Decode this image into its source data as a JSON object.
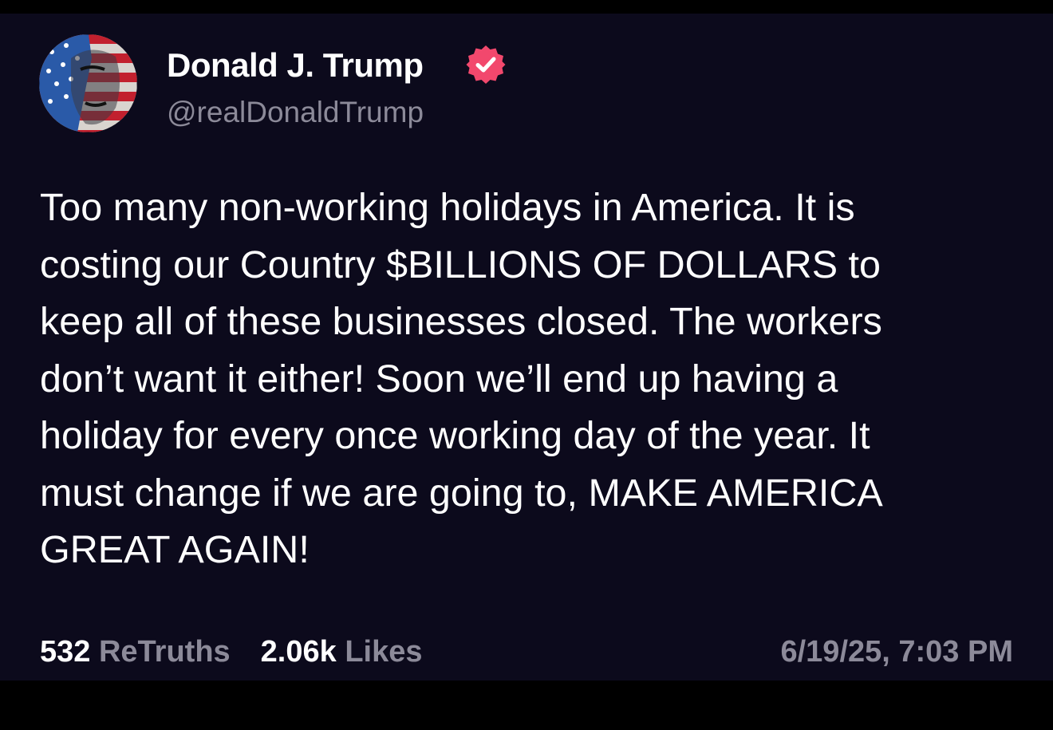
{
  "author": {
    "display_name": "Donald J. Trump",
    "handle": "@realDonaldTrump",
    "verified": true,
    "verified_icon": "verified-badge-icon",
    "avatar_icon": "stars-and-stripes-portrait-avatar"
  },
  "post": {
    "lines": [
      "Too many non-working holidays in America. It is",
      "costing our Country $BILLIONS OF DOLLARS to",
      "keep all of these businesses closed. The workers",
      "don’t want it either! Soon we’ll end up having a",
      "holiday for every once working day of the year. It",
      "must change if we are going to, MAKE AMERICA",
      "GREAT AGAIN!"
    ]
  },
  "stats": {
    "retruths_count": "532",
    "retruths_label": "ReTruths",
    "likes_count": "2.06k",
    "likes_label": "Likes"
  },
  "timestamp": "6/19/25, 7:03 PM",
  "colors": {
    "background": "#0c0a1c",
    "text": "#ffffff",
    "muted": "#8c8a99",
    "verified_badge": "#f2486d"
  }
}
